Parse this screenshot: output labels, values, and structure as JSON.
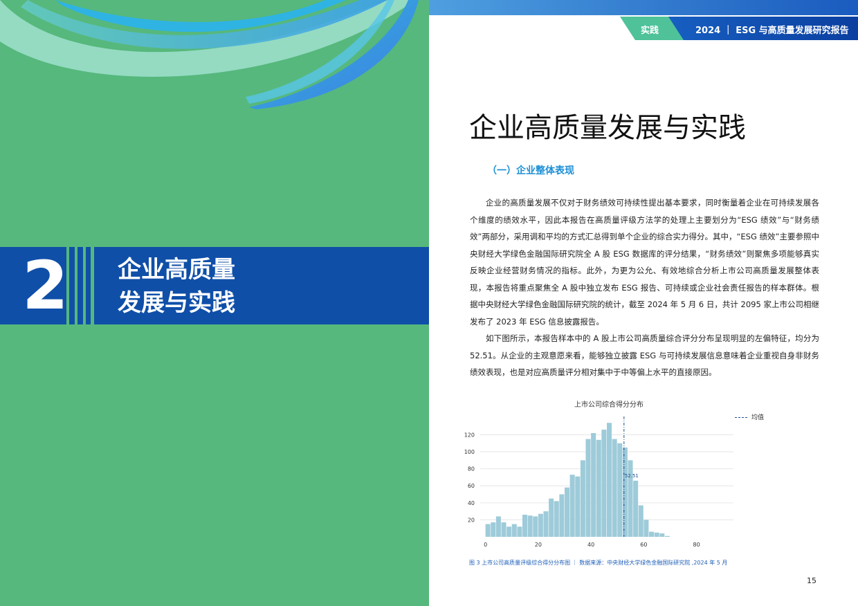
{
  "header": {
    "tag": "实践",
    "report_title": "2024 ｜ ESG 与高质量发展研究报告"
  },
  "chapter": {
    "number": "2",
    "title_line1": "企业高质量",
    "title_line2": "发展与实践"
  },
  "page_title": "企业高质量发展与实践",
  "section_heading": "（一）企业整体表现",
  "paragraphs": [
    "企业的高质量发展不仅对于财务绩效可持续性提出基本要求，同时衡量着企业在可持续发展各个维度的绩效水平，因此本报告在高质量评级方法学的处理上主要划分为“ESG 绩效”与“财务绩效”两部分，采用调和平均的方式汇总得到单个企业的综合实力得分。其中，“ESG 绩效”主要参照中央财经大学绿色金融国际研究院全 A 股 ESG 数据库的评分结果，“财务绩效”则聚焦多项能够真实反映企业经营财务情况的指标。此外，为更为公允、有效地综合分析上市公司高质量发展整体表现，本报告将重点聚焦全 A 股中独立发布 ESG 报告、可持续或企业社会责任报告的样本群体。根据中央财经大学绿色金融国际研究院的统计，截至 2024 年 5 月 6 日，共计 2095 家上市公司相继发布了 2023 年 ESG 信息披露报告。",
    "如下图所示，本报告样本中的 A 股上市公司高质量综合评分分布呈现明显的左偏特征，均分为 52.51。从企业的主观意愿来看，能够独立披露 ESG 与可持续发展信息意味着企业重视自身非财务绩效表现，也是对应高质量评分相对集中于中等偏上水平的直接原因。"
  ],
  "chart_data": {
    "type": "bar",
    "title": "上市公司综合得分分布",
    "legend": "均值",
    "legend_position": "top-right",
    "mean": 52.51,
    "mean_label": "52.51",
    "xlim": [
      -2,
      94
    ],
    "ylim": [
      0,
      135
    ],
    "x_ticks": [
      "0",
      "20",
      "40",
      "60",
      "80"
    ],
    "y_ticks": [
      "20",
      "40",
      "60",
      "80",
      "100",
      "120"
    ],
    "bin_width": 2,
    "bin_start": 0,
    "values": [
      15,
      17,
      24,
      17,
      12,
      15,
      12,
      26,
      25,
      24,
      27,
      30,
      45,
      42,
      50,
      58,
      73,
      71,
      90,
      115,
      122,
      114,
      126,
      134,
      115,
      110,
      105,
      90,
      66,
      37,
      20,
      6,
      5,
      4,
      1
    ],
    "grid": "horizontal",
    "bar_color": "#9ecbd9"
  },
  "caption": "图 3 上市公司高质量评级综合得分分布图 ｜ 数据来源：中央财经大学绿色金融国际研究院 ,2024 年 5 月",
  "page_number": "15",
  "colors": {
    "left_bg": "#56b87c",
    "band": "#0f4fa8",
    "accent": "#1b8fd6",
    "tag": "#4fc29a"
  }
}
